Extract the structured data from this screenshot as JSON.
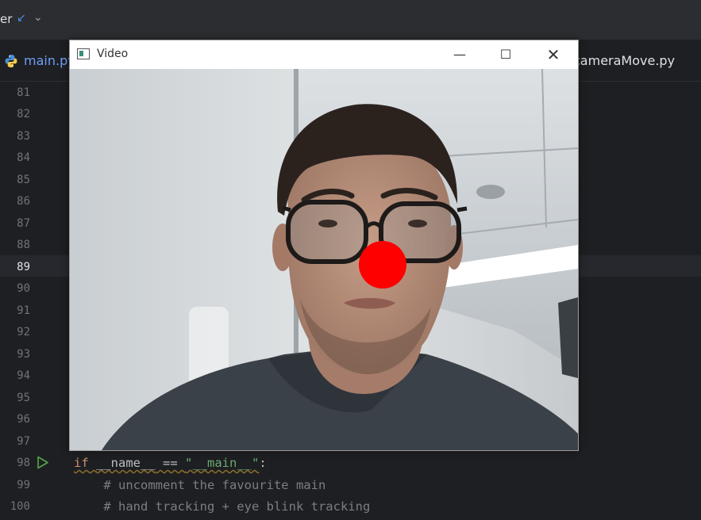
{
  "topbar": {
    "project_fragment": "er"
  },
  "tabs": {
    "left_label": "main.py",
    "right_label": "cameraMove.py"
  },
  "gutter": {
    "line_numbers": [
      "81",
      "82",
      "83",
      "84",
      "85",
      "86",
      "87",
      "88",
      "89",
      "90",
      "91",
      "92",
      "93",
      "94",
      "95",
      "96",
      "97",
      "98",
      "99",
      "100"
    ],
    "active_line": "89"
  },
  "code": {
    "line98_kw": "if",
    "line98_name": "__name__",
    "line98_op": " == ",
    "line98_str": "\"__main__\"",
    "line98_colon": ":",
    "line99": "    # uncomment the favourite main",
    "line100": "    # hand tracking + eye blink tracking"
  },
  "video_window": {
    "title": "Video",
    "minimize_glyph": "—",
    "maximize_glyph": "☐",
    "close_glyph": "✕"
  },
  "colors": {
    "editor_bg": "#1e1f22",
    "keyword": "#cf8e6d",
    "string": "#6aab73",
    "comment": "#7a7e85",
    "nose_marker": "#ff0000"
  }
}
